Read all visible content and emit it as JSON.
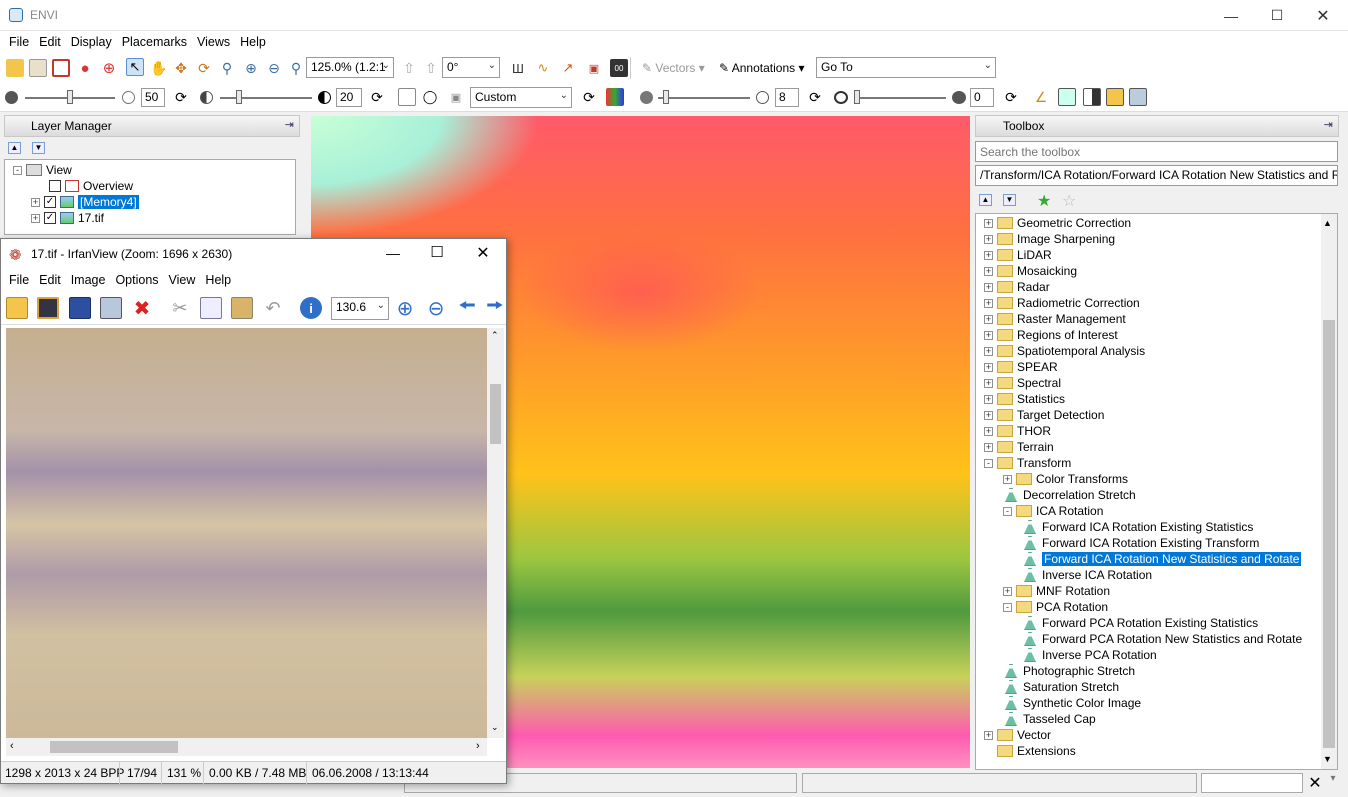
{
  "app": {
    "title": "ENVI"
  },
  "menu": [
    "File",
    "Edit",
    "Display",
    "Placemarks",
    "Views",
    "Help"
  ],
  "toolbar": {
    "zoom_value": "125.0% (1.2:1",
    "rotation_value": "0°",
    "vectors_label": "Vectors",
    "annotations_label": "Annotations",
    "goto_value": "Go To",
    "brightness_value": "50",
    "contrast_value": "20",
    "stretch_value": "Custom",
    "sharpen_value": "8",
    "transparency_value": "0"
  },
  "layer_manager": {
    "title": "Layer Manager",
    "items": [
      {
        "label": "View"
      },
      {
        "label": "Overview",
        "checked": false
      },
      {
        "label": "[Memory4]",
        "checked": true,
        "selected": true
      },
      {
        "label": "17.tif",
        "checked": true
      }
    ]
  },
  "toolbox": {
    "title": "Toolbox",
    "search_placeholder": "Search the toolbox",
    "path": "/Transform/ICA Rotation/Forward ICA Rotation New Statistics and Rotate",
    "items": [
      {
        "label": "Geometric Correction",
        "type": "folder",
        "level": 0,
        "exp": "+"
      },
      {
        "label": "Image Sharpening",
        "type": "folder",
        "level": 0,
        "exp": "+"
      },
      {
        "label": "LiDAR",
        "type": "folder",
        "level": 0,
        "exp": "+"
      },
      {
        "label": "Mosaicking",
        "type": "folder",
        "level": 0,
        "exp": "+"
      },
      {
        "label": "Radar",
        "type": "folder",
        "level": 0,
        "exp": "+"
      },
      {
        "label": "Radiometric Correction",
        "type": "folder",
        "level": 0,
        "exp": "+"
      },
      {
        "label": "Raster Management",
        "type": "folder",
        "level": 0,
        "exp": "+"
      },
      {
        "label": "Regions of Interest",
        "type": "folder",
        "level": 0,
        "exp": "+"
      },
      {
        "label": "Spatiotemporal Analysis",
        "type": "folder",
        "level": 0,
        "exp": "+"
      },
      {
        "label": "SPEAR",
        "type": "folder",
        "level": 0,
        "exp": "+"
      },
      {
        "label": "Spectral",
        "type": "folder",
        "level": 0,
        "exp": "+"
      },
      {
        "label": "Statistics",
        "type": "folder",
        "level": 0,
        "exp": "+"
      },
      {
        "label": "Target Detection",
        "type": "folder",
        "level": 0,
        "exp": "+"
      },
      {
        "label": "THOR",
        "type": "folder",
        "level": 0,
        "exp": "+"
      },
      {
        "label": "Terrain",
        "type": "folder",
        "level": 0,
        "exp": "+"
      },
      {
        "label": "Transform",
        "type": "folder",
        "level": 0,
        "exp": "-"
      },
      {
        "label": "Color Transforms",
        "type": "folder",
        "level": 1,
        "exp": "+"
      },
      {
        "label": "Decorrelation Stretch",
        "type": "tool",
        "level": 1
      },
      {
        "label": "ICA Rotation",
        "type": "folder",
        "level": 1,
        "exp": "-"
      },
      {
        "label": "Forward ICA Rotation Existing Statistics",
        "type": "tool",
        "level": 2
      },
      {
        "label": "Forward ICA Rotation Existing Transform",
        "type": "tool",
        "level": 2
      },
      {
        "label": "Forward ICA Rotation New Statistics and Rotate",
        "type": "tool",
        "level": 2,
        "selected": true
      },
      {
        "label": "Inverse ICA Rotation",
        "type": "tool",
        "level": 2
      },
      {
        "label": "MNF Rotation",
        "type": "folder",
        "level": 1,
        "exp": "+"
      },
      {
        "label": "PCA Rotation",
        "type": "folder",
        "level": 1,
        "exp": "-"
      },
      {
        "label": "Forward PCA Rotation Existing Statistics",
        "type": "tool",
        "level": 2
      },
      {
        "label": "Forward PCA Rotation New Statistics and Rotate",
        "type": "tool",
        "level": 2
      },
      {
        "label": "Inverse PCA Rotation",
        "type": "tool",
        "level": 2
      },
      {
        "label": "Photographic Stretch",
        "type": "tool",
        "level": 1
      },
      {
        "label": "Saturation Stretch",
        "type": "tool",
        "level": 1
      },
      {
        "label": "Synthetic Color Image",
        "type": "tool",
        "level": 1
      },
      {
        "label": "Tasseled Cap",
        "type": "tool",
        "level": 1
      },
      {
        "label": "Vector",
        "type": "folder",
        "level": 0,
        "exp": "+"
      },
      {
        "label": "Extensions",
        "type": "folder",
        "level": 0
      }
    ]
  },
  "irfanview": {
    "title": "17.tif - IrfanView (Zoom: 1696 x 2630)",
    "menu": [
      "File",
      "Edit",
      "Image",
      "Options",
      "View",
      "Help"
    ],
    "zoom_value": "130.6",
    "status": [
      "1298 x 2013 x 24 BPP",
      "17/94",
      "131 %",
      "0.00 KB / 7.48 MB",
      "06.06.2008 / 13:13:44"
    ]
  }
}
